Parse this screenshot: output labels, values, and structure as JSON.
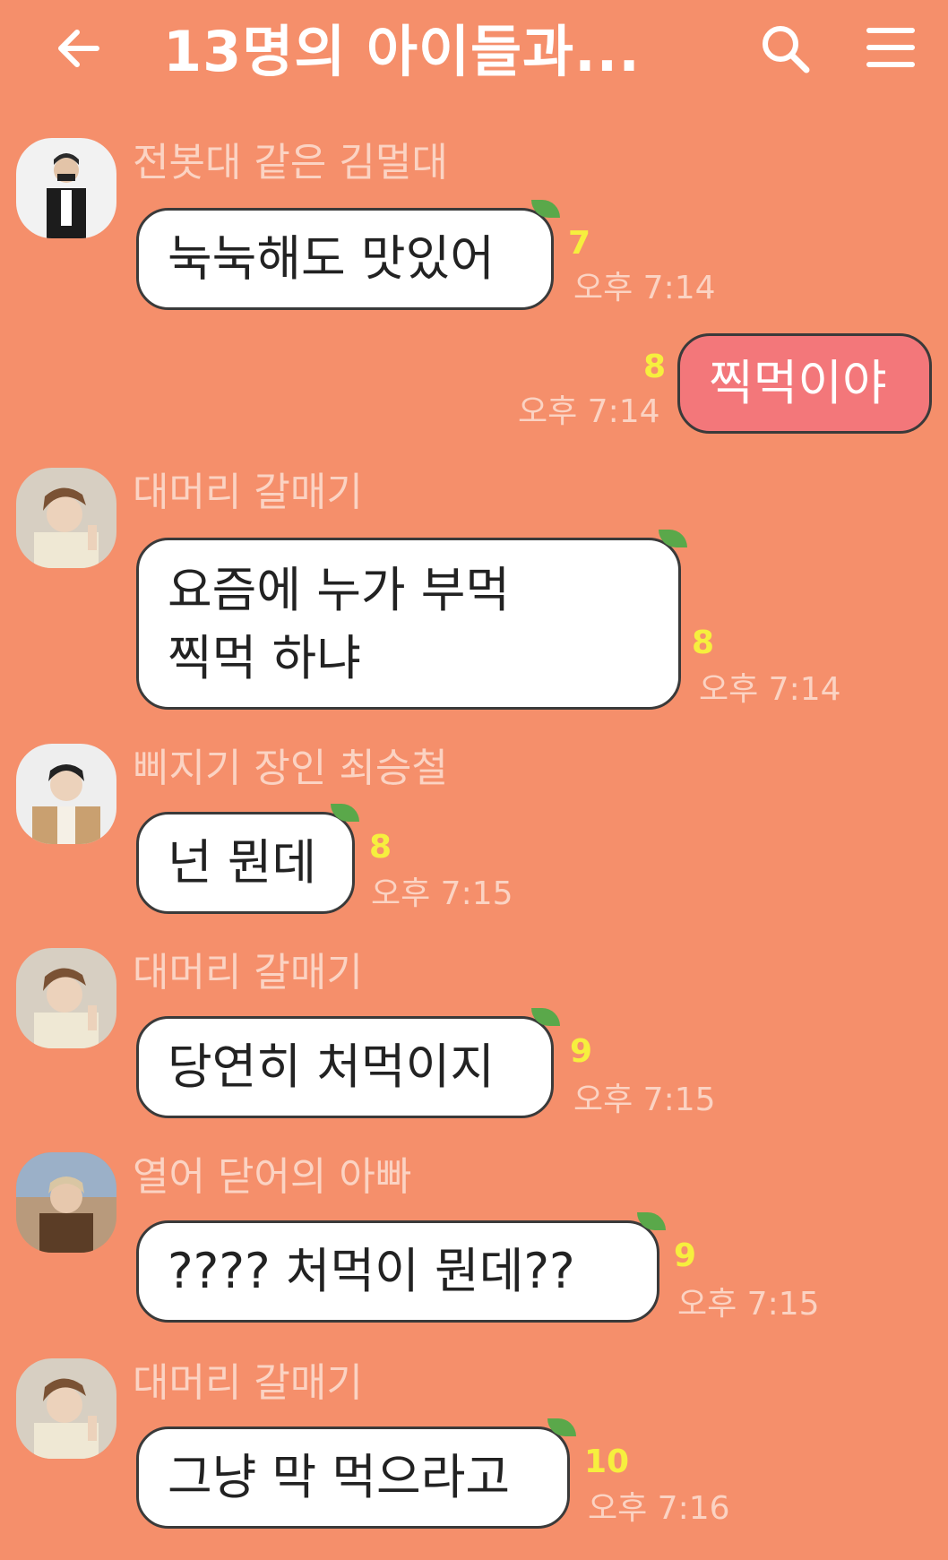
{
  "header": {
    "title": "13명의 아이들과...",
    "back_icon": "back-arrow-icon",
    "search_icon": "search-icon",
    "menu_icon": "hamburger-menu-icon"
  },
  "messages": [
    {
      "sender": "전봇대 같은 김멀대",
      "lines": [
        "눅눅해도 맛있어"
      ],
      "count": "7",
      "time": "오후 7:14"
    },
    {
      "mine": true,
      "lines": [
        "찍먹이야"
      ],
      "count": "8",
      "time": "오후 7:14"
    },
    {
      "sender": "대머리 갈매기",
      "lines": [
        "요즘에 누가 부먹",
        "찍먹 하냐"
      ],
      "count": "8",
      "time": "오후 7:14"
    },
    {
      "sender": "삐지기 장인 최승철",
      "lines": [
        "넌 뭔데"
      ],
      "count": "8",
      "time": "오후 7:15"
    },
    {
      "sender": "대머리 갈매기",
      "lines": [
        "당연히 처먹이지"
      ],
      "count": "9",
      "time": "오후 7:15"
    },
    {
      "sender": "열어 닫어의 아빠",
      "lines": [
        "???? 처먹이 뭔데??"
      ],
      "count": "9",
      "time": "오후 7:15"
    },
    {
      "sender": "대머리 갈매기",
      "lines": [
        "그냥 막 먹으라고"
      ],
      "count": "10",
      "time": "오후 7:16"
    }
  ],
  "colors": {
    "background": "#f58f6b",
    "my_bubble": "#f3777a",
    "read_count": "#f6ef3e",
    "meta_text": "#fbd3c3"
  }
}
